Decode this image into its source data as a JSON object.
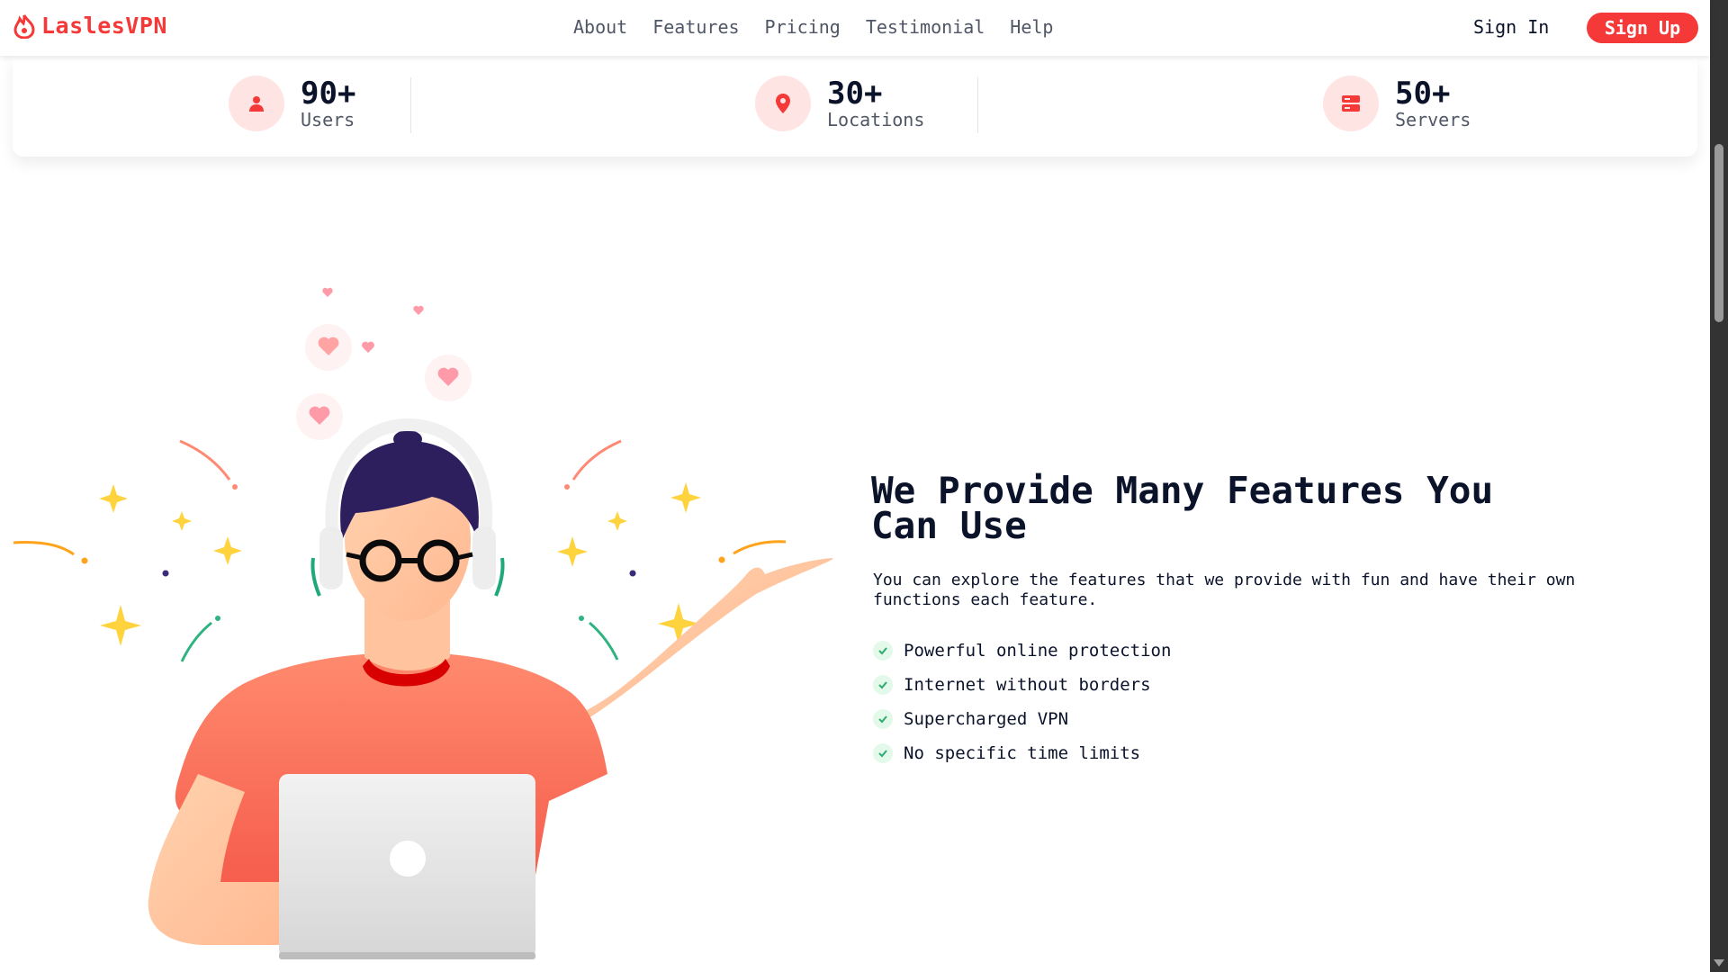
{
  "header": {
    "logo_text": "LaslesVPN",
    "nav": [
      {
        "label": "About"
      },
      {
        "label": "Features"
      },
      {
        "label": "Pricing"
      },
      {
        "label": "Testimonial"
      },
      {
        "label": "Help"
      }
    ],
    "signin_label": "Sign In",
    "signup_label": "Sign Up"
  },
  "stats": [
    {
      "value": "90+",
      "label": "Users",
      "icon": "user-icon"
    },
    {
      "value": "30+",
      "label": "Locations",
      "icon": "location-pin-icon"
    },
    {
      "value": "50+",
      "label": "Servers",
      "icon": "server-icon"
    }
  ],
  "features": {
    "title": "We Provide Many Features You Can Use",
    "description": "You can explore the features that we provide with fun and have their own functions each feature.",
    "items": [
      "Powerful online protection",
      "Internet without borders",
      "Supercharged VPN",
      "No specific time limits"
    ]
  },
  "colors": {
    "accent": "#f53838",
    "text_dark": "#0b132a",
    "text_muted": "#4f5665",
    "icon_bg": "#ffe4e4",
    "check_bg": "#e3f9e9",
    "check": "#2fab73"
  }
}
